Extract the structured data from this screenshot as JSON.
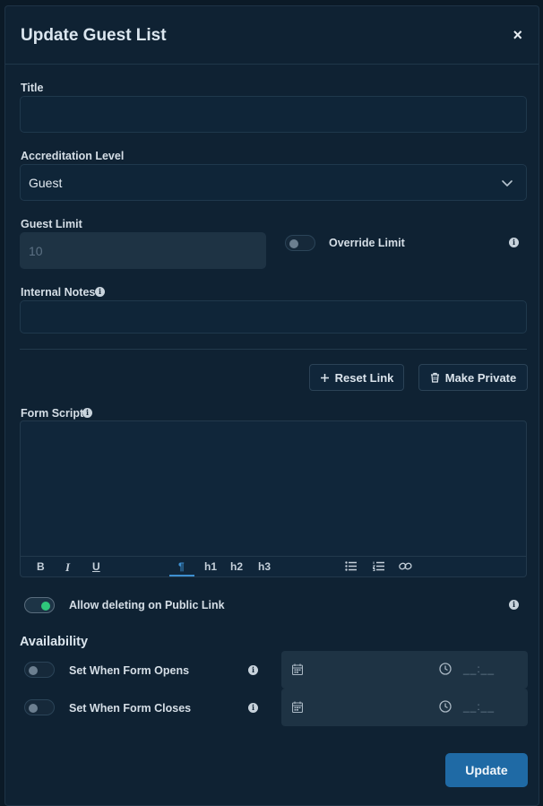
{
  "modal": {
    "title": "Update Guest List",
    "close_label": "×"
  },
  "form": {
    "title_label": "Title",
    "title_value": "",
    "accreditation_label": "Accreditation Level",
    "accreditation_value": "Guest",
    "guest_limit_label": "Guest Limit",
    "guest_limit_placeholder": "10",
    "override_label": "Override Limit",
    "override_on": false,
    "notes_label": "Internal Notes",
    "notes_value": "",
    "reset_link_label": "Reset Link",
    "make_private_label": "Make Private",
    "form_script_label": "Form Script",
    "editor_toolbar": {
      "bold": "B",
      "italic": "I",
      "underline": "U",
      "paragraph": "¶",
      "h1": "h1",
      "h2": "h2",
      "h3": "h3"
    },
    "allow_delete_label": "Allow deleting on Public Link",
    "allow_delete_on": true
  },
  "availability": {
    "heading": "Availability",
    "opens_label": "Set When Form Opens",
    "closes_label": "Set When Form Closes",
    "time_placeholder": "__:__"
  },
  "update_label": "Update",
  "colors": {
    "background": "#0f2233",
    "primary": "#1f6aa5",
    "toggle_on": "#2fc77b",
    "accent": "#3d8fd0"
  },
  "icons": [
    "close-icon",
    "chevron-down-icon",
    "info-icon",
    "plus-icon",
    "trash-icon",
    "calendar-icon",
    "clock-icon",
    "bold-icon",
    "italic-icon",
    "underline-icon",
    "paragraph-icon",
    "bullet-list-icon",
    "numbered-list-icon",
    "link-icon"
  ]
}
